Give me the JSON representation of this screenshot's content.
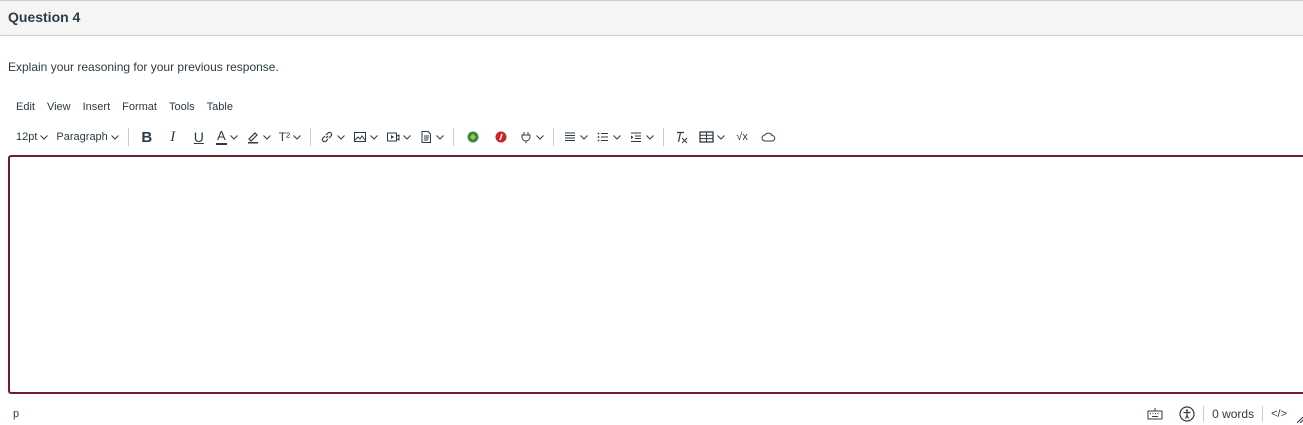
{
  "question": {
    "title": "Question 4",
    "prompt": "Explain your reasoning for your previous response."
  },
  "menubar": {
    "items": [
      "Edit",
      "View",
      "Insert",
      "Format",
      "Tools",
      "Table"
    ]
  },
  "toolbar": {
    "font_size": "12pt",
    "block_format": "Paragraph",
    "bold": "B",
    "italic": "I",
    "underline": "U",
    "text_color": "A",
    "superscript": "T²",
    "math": "√x"
  },
  "editor": {
    "content": "",
    "border_color": "#6b1f2a"
  },
  "statusbar": {
    "path": "p",
    "word_count": "0 words",
    "html_toggle": "</>"
  },
  "icons": [
    "chevron-down-icon",
    "highlighter-icon",
    "link-icon",
    "image-icon",
    "media-icon",
    "document-icon",
    "apps-icon",
    "equation-icon",
    "embed-icon",
    "align-icon",
    "bullet-list-icon",
    "indent-icon",
    "clear-format-icon",
    "table-icon",
    "cloud-icon",
    "keyboard-icon",
    "accessibility-icon",
    "resize-icon"
  ]
}
